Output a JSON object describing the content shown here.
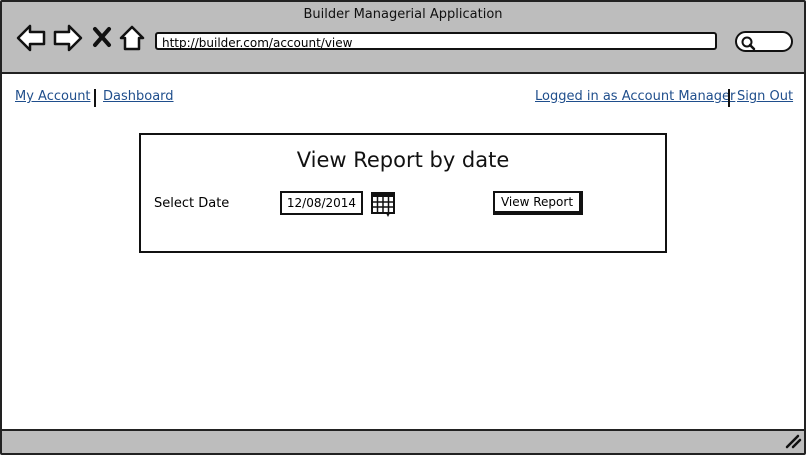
{
  "window": {
    "title": "Builder Managerial Application"
  },
  "toolbar": {
    "back_icon": "back-arrow-icon",
    "forward_icon": "forward-arrow-icon",
    "stop_icon": "close-icon",
    "home_icon": "home-icon",
    "search_icon": "search-icon"
  },
  "address_bar": {
    "url": "http://builder.com/account/view"
  },
  "nav": {
    "left_links": [
      "My Account",
      "Dashboard"
    ],
    "logged_in": "Logged in as Account Manager",
    "sign_out": "Sign Out"
  },
  "report_panel": {
    "title": "View Report by date",
    "date_label": "Select Date",
    "date_value": "12/08/2014",
    "calendar_icon": "calendar-icon",
    "button_label": "View Report"
  },
  "colors": {
    "chrome_bg": "#bdbdbd",
    "link": "#1f4e8c",
    "border": "#111111"
  }
}
